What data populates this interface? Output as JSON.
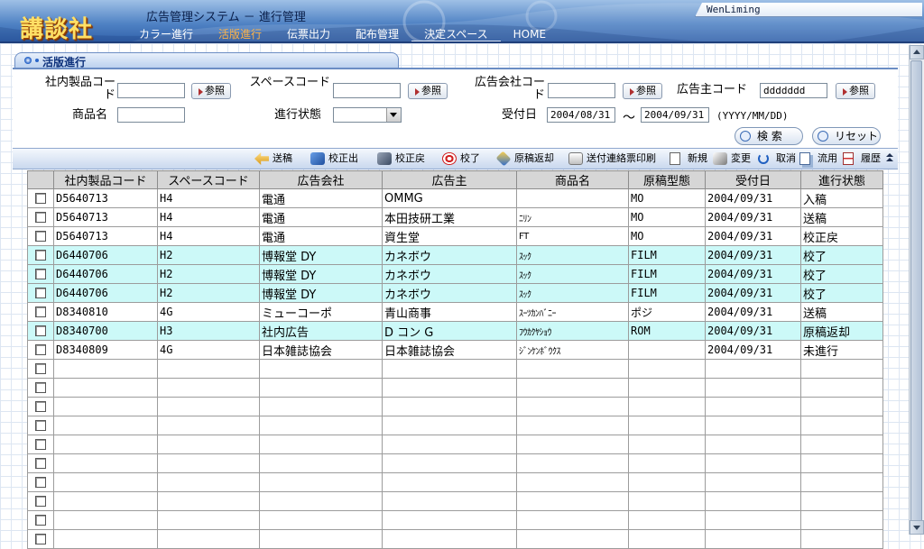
{
  "header": {
    "logo": "講談社",
    "system_title": "広告管理システム － 進行管理",
    "user": "WenLiming",
    "nav": [
      {
        "label": "カラー進行"
      },
      {
        "label": "活版進行"
      },
      {
        "label": "伝票出力"
      },
      {
        "label": "配布管理"
      },
      {
        "label": "決定スペース"
      },
      {
        "label": "HOME"
      }
    ]
  },
  "panel": {
    "title": "活版進行"
  },
  "search": {
    "product_code_label": "社内製品コード",
    "space_code_label": "スペースコード",
    "ad_company_code_label": "広告会社コード",
    "advertiser_code_label": "広告主コード",
    "advertiser_code_value": "ddddddd",
    "ref_label": "参照",
    "product_name_label": "商品名",
    "status_label": "進行状態",
    "received_label": "受付日",
    "date_from": "2004/08/31",
    "date_tilde": "～",
    "date_to": "2004/09/31",
    "date_format": "(YYYY/MM/DD)",
    "search_button": "検 索",
    "reset_button": "リセット"
  },
  "toolbar": [
    {
      "label": "送稿",
      "icon": "arrow-left-icon"
    },
    {
      "label": "校正出",
      "icon": "pencil-check-icon"
    },
    {
      "label": "校正戻",
      "icon": "pencil-cross-icon"
    },
    {
      "label": "校了",
      "icon": "target-arrow-icon"
    },
    {
      "label": "原稿返却",
      "icon": "diamond-return-icon"
    },
    {
      "label": "送付連絡票印刷",
      "icon": "print-icon"
    },
    {
      "label": "新規",
      "icon": "new-document-icon"
    },
    {
      "label": "変更",
      "icon": "edit-icon"
    },
    {
      "label": "取消",
      "icon": "undo-icon"
    },
    {
      "label": "流用",
      "icon": "copy-icon"
    },
    {
      "label": "履歴",
      "icon": "history-icon"
    }
  ],
  "table": {
    "headers": [
      "社内製品コード",
      "スペースコード",
      "広告会社",
      "広告主",
      "商品名",
      "原稿型態",
      "受付日",
      "進行状態"
    ],
    "rows": [
      {
        "c0": "D5640713",
        "c1": "H4",
        "c2": "電通",
        "c3": "OMMG",
        "c4": "",
        "c5": "MO",
        "c6": "2004/09/31",
        "c7": "入稿",
        "hl": false
      },
      {
        "c0": "D5640713",
        "c1": "H4",
        "c2": "電通",
        "c3": "本田技研工業",
        "c4": "ﾆﾘﾝ",
        "c5": "MO",
        "c6": "2004/09/31",
        "c7": "送稿",
        "hl": false
      },
      {
        "c0": "D5640713",
        "c1": "H4",
        "c2": "電通",
        "c3": "資生堂",
        "c4": "FT",
        "c5": "MO",
        "c6": "2004/09/31",
        "c7": "校正戻",
        "hl": false
      },
      {
        "c0": "D6440706",
        "c1": "H2",
        "c2": "博報堂 DY",
        "c3": "カネボウ",
        "c4": "ｽｯｸ",
        "c5": "FILM",
        "c6": "2004/09/31",
        "c7": "校了",
        "hl": true
      },
      {
        "c0": "D6440706",
        "c1": "H2",
        "c2": "博報堂 DY",
        "c3": "カネボウ",
        "c4": "ｽｯｸ",
        "c5": "FILM",
        "c6": "2004/09/31",
        "c7": "校了",
        "hl": true
      },
      {
        "c0": "D6440706",
        "c1": "H2",
        "c2": "博報堂 DY",
        "c3": "カネボウ",
        "c4": "ｽｯｸ",
        "c5": "FILM",
        "c6": "2004/09/31",
        "c7": "校了",
        "hl": true
      },
      {
        "c0": "D8340810",
        "c1": "4G",
        "c2": "ミューコーポ",
        "c3": "青山商事",
        "c4": "ｽｰﾂｶﾝﾊﾞﾆｰ",
        "c5": "ポジ",
        "c6": "2004/09/31",
        "c7": "送稿",
        "hl": false
      },
      {
        "c0": "D8340700",
        "c1": "H3",
        "c2": "社内広告",
        "c3": "D コン G",
        "c4": "ﾌｳｶｸﾔｼｮｳ",
        "c5": "ROM",
        "c6": "2004/09/31",
        "c7": "原稿返却",
        "hl": true
      },
      {
        "c0": "D8340809",
        "c1": "4G",
        "c2": "日本雑誌協会",
        "c3": "日本雑誌協会",
        "c4": "ｼﾞﾝｹﾝﾎﾞｳｸｽ",
        "c5": "",
        "c6": "2004/09/31",
        "c7": "未進行",
        "hl": false
      }
    ],
    "empty_rows": 10
  },
  "colors": {
    "header_blue": "#4f82c4",
    "nav_active": "#ffb347",
    "row_highlight": "#ccf9f8",
    "logo_gold": "#ffe066"
  }
}
